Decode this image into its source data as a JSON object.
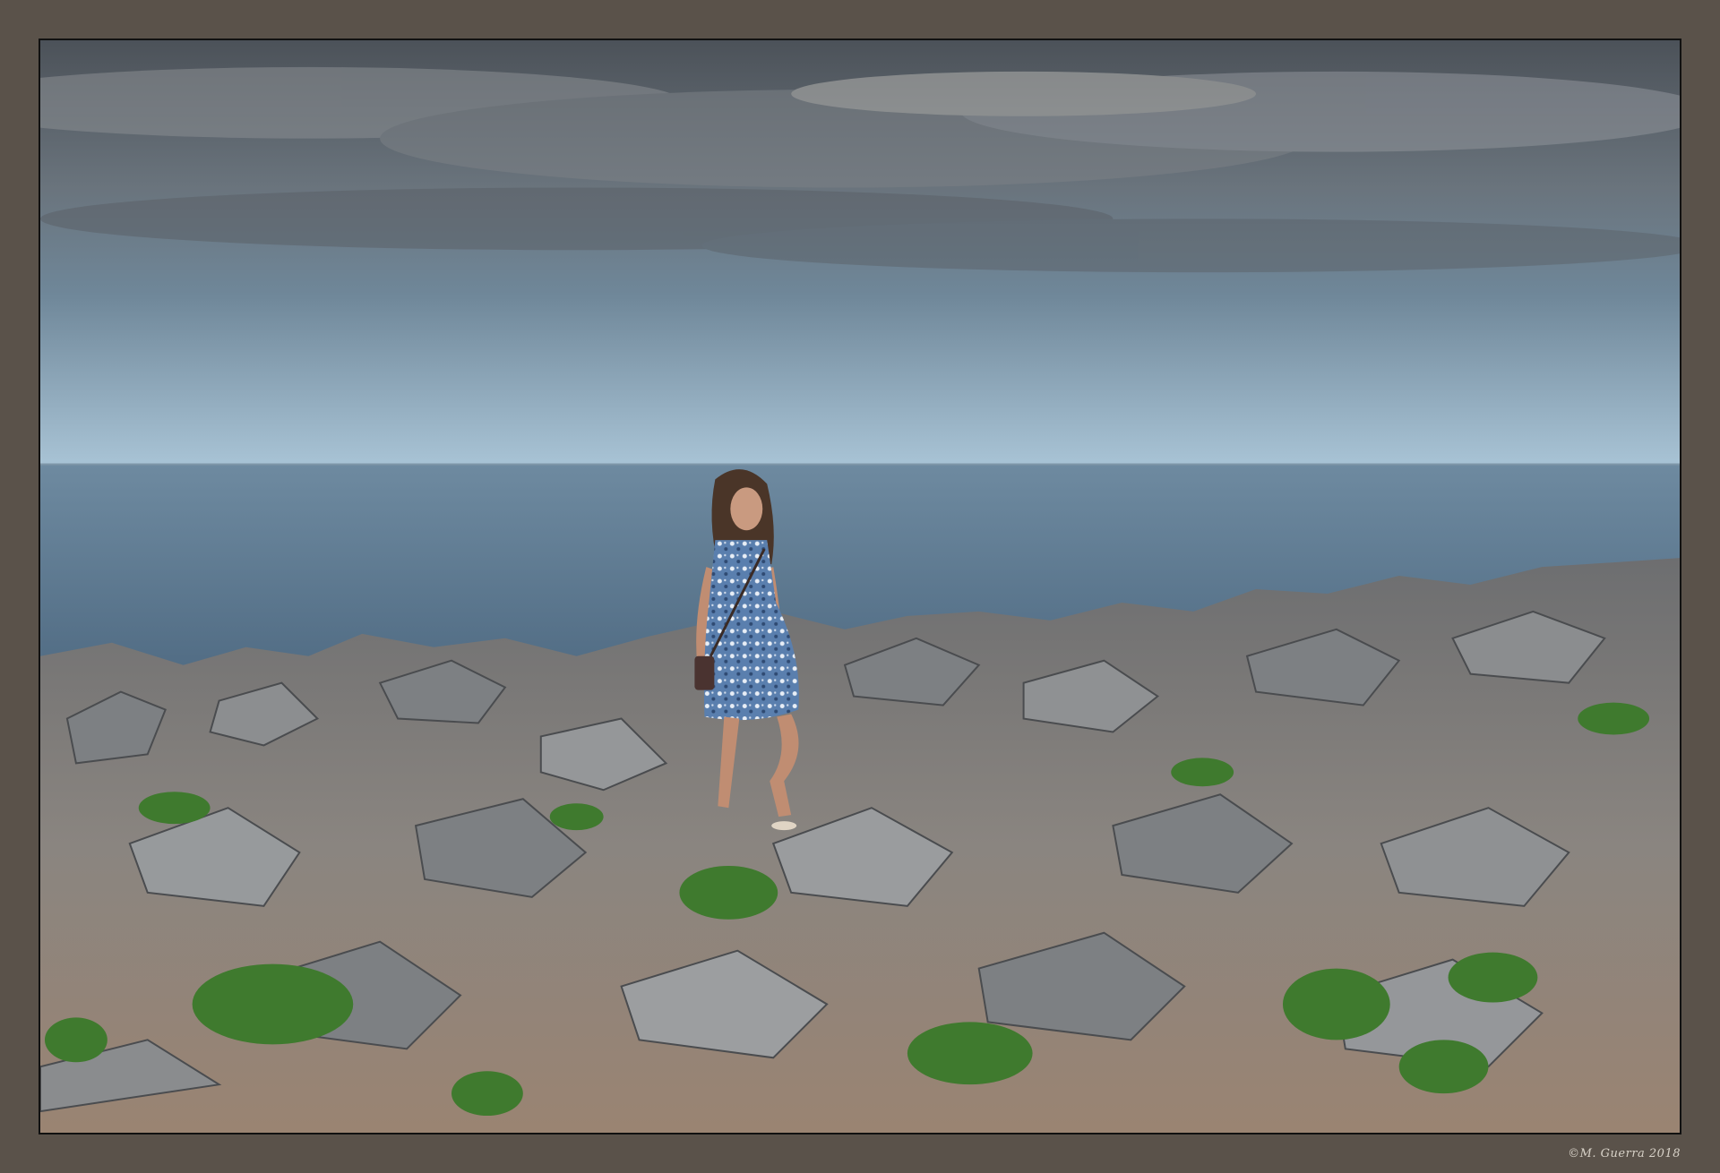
{
  "watermark": "©M. Guerra 2018",
  "colors": {
    "frame": "#5a524a",
    "sky_top": "#4f555c",
    "sky_horizon": "#a9c4d6",
    "sea": "#5f7a90",
    "rock": "#8b8d8f",
    "soil": "#a07f62",
    "vegetation": "#3f7a2e",
    "dress": "#4b6f9c"
  }
}
